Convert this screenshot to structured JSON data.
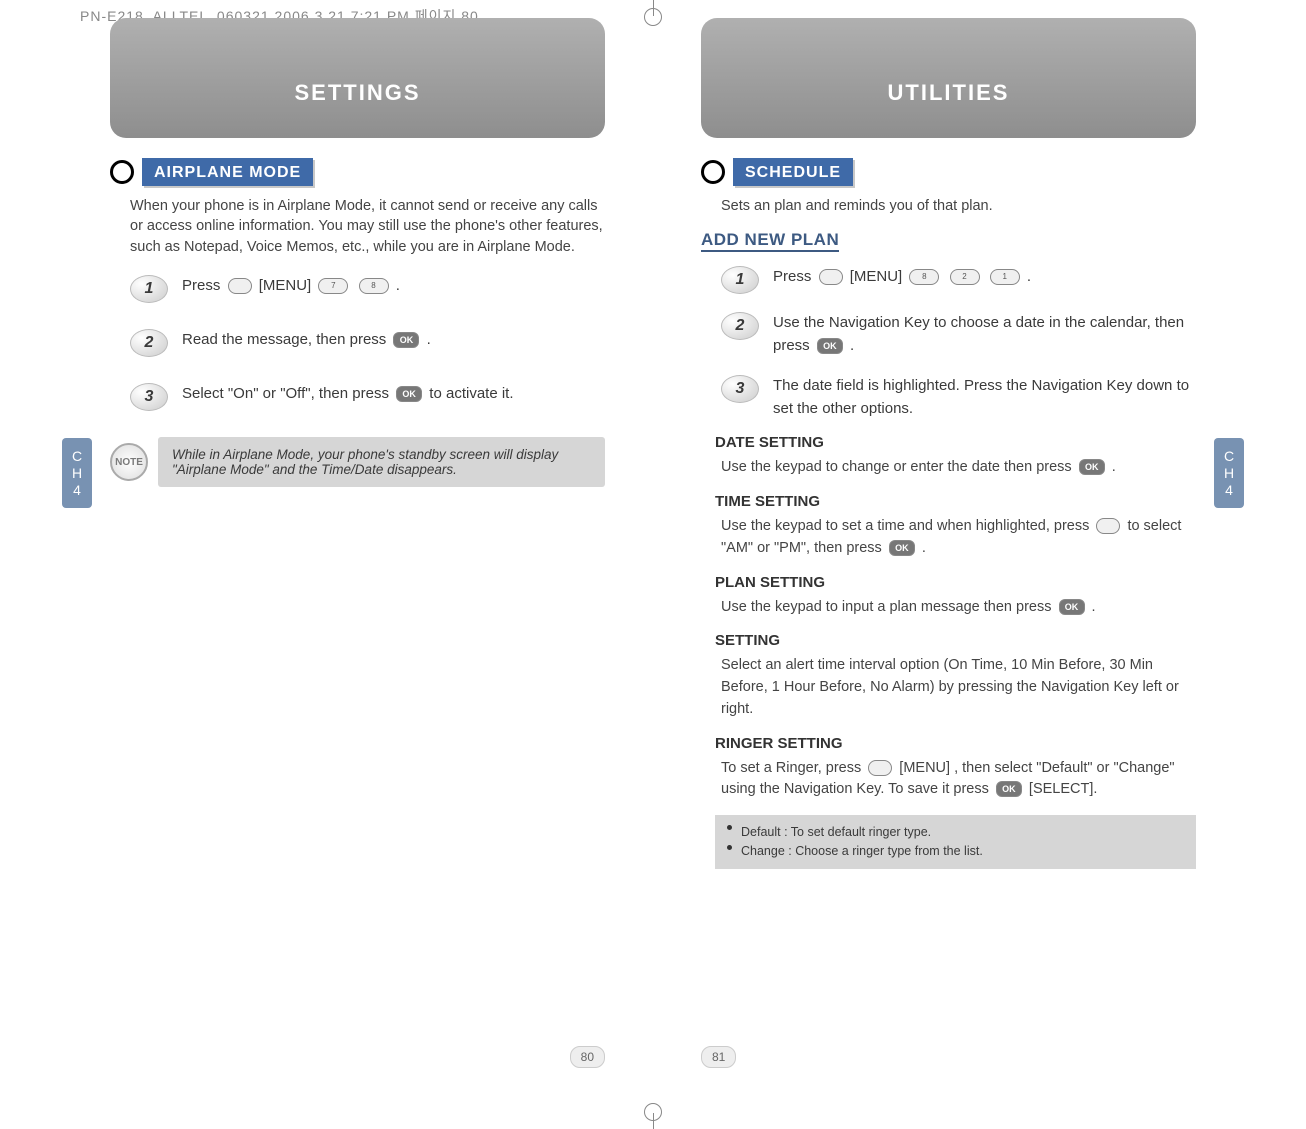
{
  "print_header": "PN-E218_ALLTEL_060321  2006.3.21  7:21 PM  페이지 80",
  "left": {
    "tab": "SETTINGS",
    "section": "AIRPLANE MODE",
    "intro": "When your phone is in Airplane Mode, it cannot send or receive any calls or access online information. You may still use the phone's other features, such as Notepad, Voice Memos, etc., while you are in Airplane Mode.",
    "steps": [
      {
        "n": "1",
        "pre": "Press ",
        "menu": "[MENU]",
        "post": " ."
      },
      {
        "n": "2",
        "text": "Read the message, then press ",
        "ok": true,
        "tail": " ."
      },
      {
        "n": "3",
        "text": "Select \"On\" or \"Off\", then press ",
        "ok": true,
        "tail": " to activate it."
      }
    ],
    "note": "While in Airplane Mode, your phone's standby screen will display \"Airplane Mode\" and the Time/Date disappears.",
    "sidetab_top": "C\nH",
    "sidetab_bot": "4",
    "pagenum": "80"
  },
  "right": {
    "tab": "UTILITIES",
    "section": "SCHEDULE",
    "intro": "Sets an plan and reminds you of that plan.",
    "subheading": "ADD NEW PLAN",
    "steps": [
      {
        "n": "1",
        "pre": "Press ",
        "menu": "[MENU]",
        "post": " ."
      },
      {
        "n": "2",
        "text": "Use the Navigation Key to choose a date in the calendar, then press ",
        "ok": true,
        "tail": " ."
      },
      {
        "n": "3",
        "text": "The date field is highlighted. Press the Navigation Key down to set the other options."
      }
    ],
    "date_h": "DATE SETTING",
    "date_p": "Use the keypad to change or enter the date then press ",
    "time_h": "TIME SETTING",
    "time_p1": "Use the keypad to set a time and when highlighted, press ",
    "time_p2": " to select \"AM\" or \"PM\", then press ",
    "plan_h": "PLAN SETTING",
    "plan_p": "Use the keypad to input a plan message then press ",
    "setting_h": "SETTING",
    "setting_p": "Select an alert time interval option (On Time, 10 Min Before, 30 Min Before, 1 Hour Before, No Alarm) by pressing the Navigation Key left or right.",
    "ringer_h": "RINGER SETTING",
    "ringer_p1": "To set a Ringer, press ",
    "ringer_menu": "[MENU]",
    "ringer_p2": ", then select \"Default\" or \"Change\" using the Navigation Key. To save it press ",
    "ringer_select": "[SELECT].",
    "bullets": [
      "Default : To set default ringer type.",
      "Change : Choose a ringer type from the list."
    ],
    "sidetab_top": "C\nH",
    "sidetab_bot": "4",
    "pagenum": "81"
  },
  "ok_label": "OK",
  "note_label": "NOTE"
}
